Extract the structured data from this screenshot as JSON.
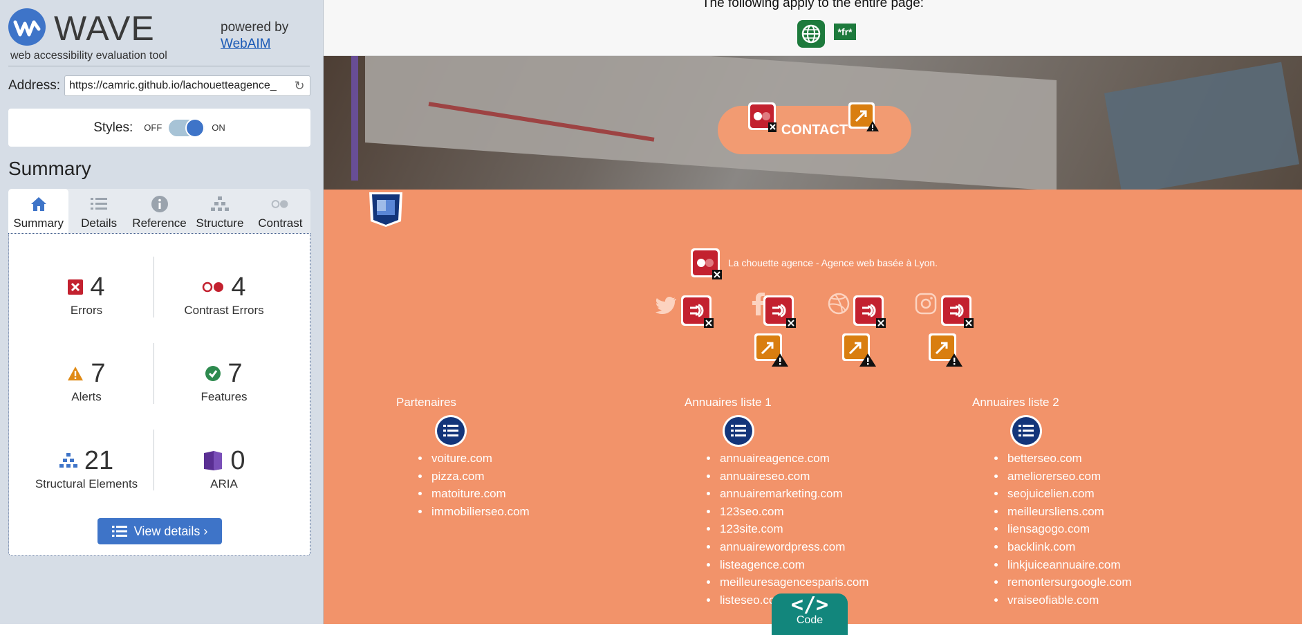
{
  "sidebar": {
    "logo_word": "WAVE",
    "tagline": "web accessibility evaluation tool",
    "powered_by": "powered by",
    "webaim_link": "WebAIM",
    "address_label": "Address:",
    "address_value": "https://camric.github.io/lachouetteagence_",
    "styles_label": "Styles:",
    "toggle_off": "OFF",
    "toggle_on": "ON",
    "toggle_state": "on",
    "summary_heading": "Summary",
    "tabs": [
      {
        "label": "Summary",
        "icon": "home-icon",
        "active": true
      },
      {
        "label": "Details",
        "icon": "list-icon",
        "active": false
      },
      {
        "label": "Reference",
        "icon": "info-icon",
        "active": false
      },
      {
        "label": "Structure",
        "icon": "structure-icon",
        "active": false
      },
      {
        "label": "Contrast",
        "icon": "contrast-icon",
        "active": false
      }
    ],
    "stats": {
      "errors": {
        "value": "4",
        "label": "Errors"
      },
      "contrast": {
        "value": "4",
        "label": "Contrast Errors"
      },
      "alerts": {
        "value": "7",
        "label": "Alerts"
      },
      "features": {
        "value": "7",
        "label": "Features"
      },
      "structural": {
        "value": "21",
        "label": "Structural Elements"
      },
      "aria": {
        "value": "0",
        "label": "ARIA"
      }
    },
    "view_details": "View details ›"
  },
  "main": {
    "apply_text": "The following apply to the entire page:",
    "lang_badge": "*fr*",
    "contact_label": "CONTACT",
    "footer_text": "La chouette agence - Agence web basée à Lyon.",
    "columns": [
      {
        "title": "Partenaires",
        "items": [
          "voiture.com",
          "pizza.com",
          "matoiture.com",
          "immobilierseo.com"
        ]
      },
      {
        "title": "Annuaires liste 1",
        "items": [
          "annuaireagence.com",
          "annuaireseo.com",
          "annuairemarketing.com",
          "123seo.com",
          "123site.com",
          "annuairewordpress.com",
          "listeagence.com",
          "meilleuresagencesparis.com",
          "listeseo.com"
        ]
      },
      {
        "title": "Annuaires liste 2",
        "items": [
          "betterseo.com",
          "ameliorerseo.com",
          "seojuicelien.com",
          "meilleursliens.com",
          "liensagogo.com",
          "backlink.com",
          "linkjuiceannuaire.com",
          "remontersurgoogle.com",
          "vraiseofiable.com"
        ]
      }
    ],
    "code_tab": "Code"
  },
  "colors": {
    "footer_bg": "#f2936a",
    "accent_blue": "#3e74c8",
    "error_red": "#c3212f",
    "alert_orange": "#d97e10",
    "feature_green": "#1d7a3c"
  }
}
